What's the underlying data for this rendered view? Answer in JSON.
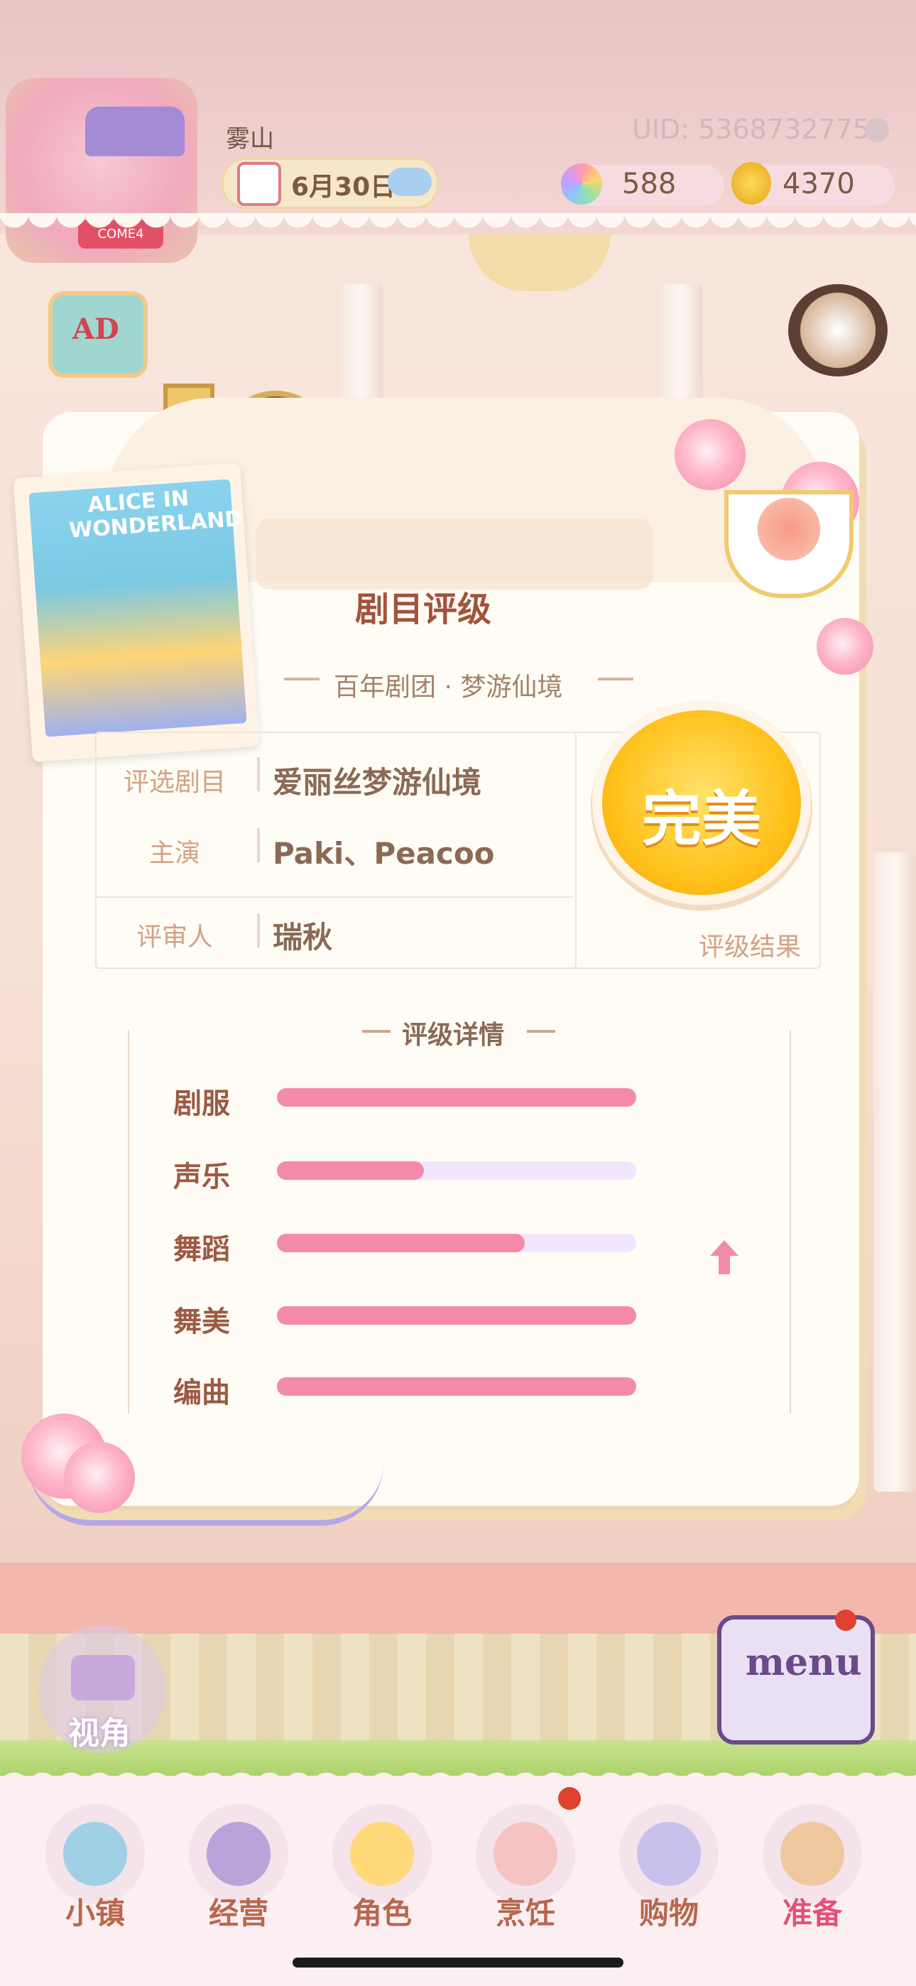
{
  "header": {
    "username": "雾山",
    "uid": "UID: 5368732775",
    "date": "6月30日",
    "currencies": [
      {
        "icon": "rainbow-flower-icon",
        "amount": "588"
      },
      {
        "icon": "gold-coin-icon",
        "amount": "4370"
      }
    ]
  },
  "side_buttons": {
    "ad_label": "AD"
  },
  "card": {
    "title": "剧目评级",
    "subtitle": "百年剧团 · 梦游仙境",
    "poster_text": "ALICE IN WONDERLAND",
    "info": [
      {
        "label": "评选剧目",
        "value": "爱丽丝梦游仙境"
      },
      {
        "label": "主演",
        "value": "Paki、Peacoo"
      },
      {
        "label": "评审人",
        "value": "瑞秋"
      }
    ],
    "result_badge": "完美",
    "result_caption": "评级结果",
    "details_title": "评级详情",
    "details": [
      {
        "label": "剧服",
        "value": 1.0
      },
      {
        "label": "声乐",
        "value": 0.41
      },
      {
        "label": "舞蹈",
        "value": 0.69
      },
      {
        "label": "舞美",
        "value": 1.0
      },
      {
        "label": "编曲",
        "value": 1.0
      }
    ],
    "improved_row": "舞蹈"
  },
  "controls": {
    "camera_label": "视角",
    "menu_label": "menu"
  },
  "nav": [
    {
      "label": "小镇",
      "icon": "map-icon",
      "active": false
    },
    {
      "label": "经营",
      "icon": "shop-bag-icon",
      "active": false
    },
    {
      "label": "角色",
      "icon": "character-icon",
      "active": false
    },
    {
      "label": "烹饪",
      "icon": "cooking-icon",
      "active": false
    },
    {
      "label": "购物",
      "icon": "shopping-bag-icon",
      "active": false
    },
    {
      "label": "准备",
      "icon": "prepare-basket-icon",
      "active": true
    }
  ],
  "colors": {
    "accent_pink": "#f48aaa",
    "track": "#f1e6fb",
    "badge_gold": "#ffc21c",
    "title_brown": "#a4523b"
  }
}
